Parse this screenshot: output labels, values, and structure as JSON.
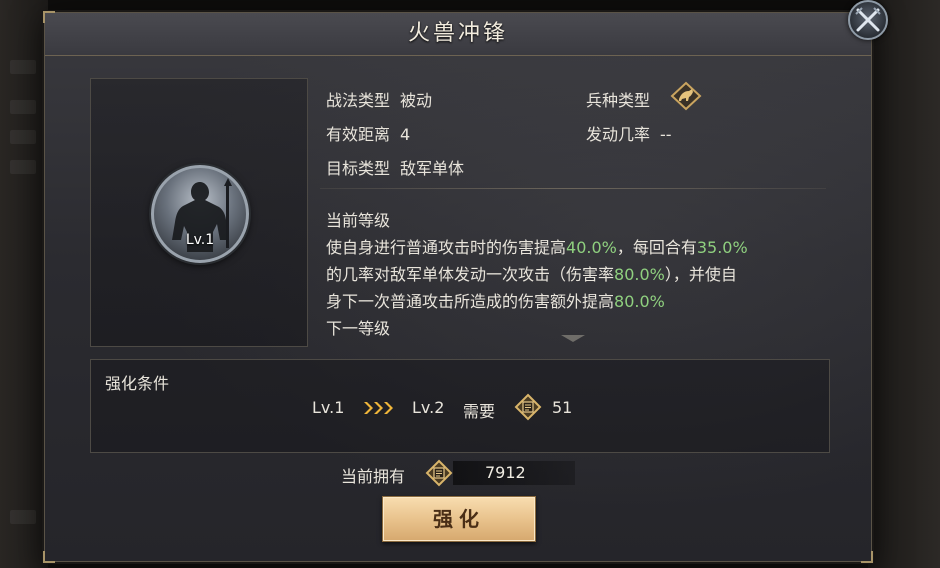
{
  "dialog": {
    "title": "火兽冲锋"
  },
  "skill": {
    "level_badge": "Lv.1",
    "tactic_type_label": "战法类型",
    "tactic_type_value": "被动",
    "unit_type_label": "兵种类型",
    "range_label": "有效距离",
    "range_value": "4",
    "trigger_rate_label": "发动几率",
    "trigger_rate_value": "--",
    "target_type_label": "目标类型",
    "target_type_value": "敌军单体"
  },
  "description": {
    "current_level_label": "当前等级",
    "line1_a": "使自身进行普通攻击时的伤害提高",
    "line1_num1": "40.0%",
    "line1_b": "，每回合有",
    "line1_num2": "35.0%",
    "line2_a": "的几率对敌军单体发动一次攻击（伤害率",
    "line2_num": "80.0%",
    "line2_b": "），并使自",
    "line3_a": "身下一次普通攻击所造成的伤害额外提高",
    "line3_num": "80.0%",
    "next_level_label": "下一等级"
  },
  "upgrade_condition": {
    "title": "强化条件",
    "from_level": "Lv.1",
    "to_level": "Lv.2",
    "need_label": "需要",
    "cost": "51"
  },
  "owned": {
    "label": "当前拥有",
    "value": "7912"
  },
  "actions": {
    "upgrade_label": "强化"
  },
  "colors": {
    "highlight_number": "#8fd07f",
    "button_gold": "#e9c38d",
    "gold_accent": "#d8b46a"
  },
  "icons": {
    "close": "crossed-swords-close-icon",
    "unit_type": "cavalry-unit-icon",
    "currency": "tactic-book-token-icon",
    "arrows": "triple-chevron-right-icon"
  }
}
